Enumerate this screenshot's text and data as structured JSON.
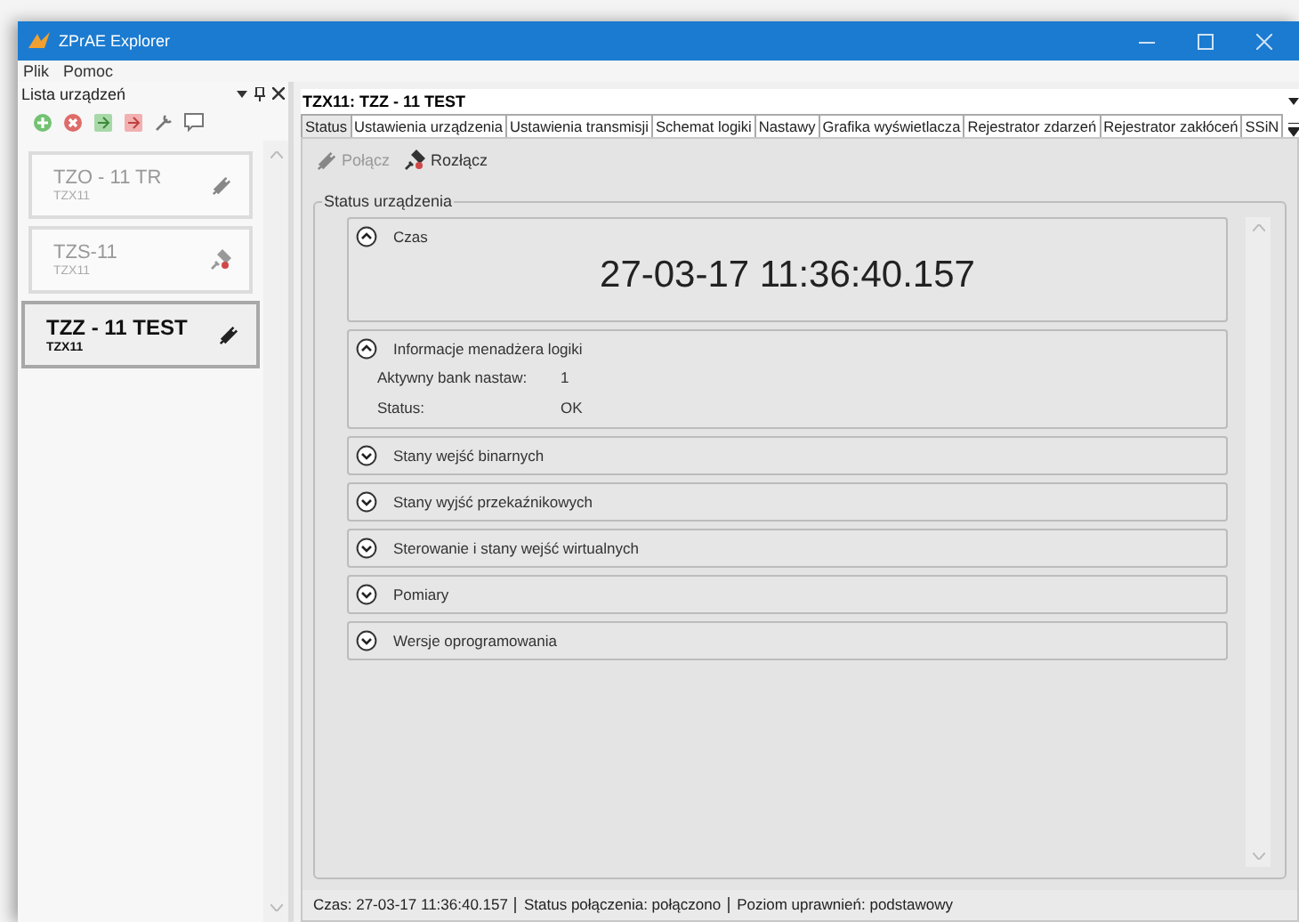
{
  "window": {
    "title": "ZPrAE Explorer"
  },
  "menu": [
    "Plik",
    "Pomoc"
  ],
  "sidebar": {
    "title": "Lista urządzeń",
    "items": [
      {
        "name": "TZO - 11 TR",
        "model": "TZX11",
        "kind": "plugged",
        "selected": false
      },
      {
        "name": "TZS-11",
        "model": "TZX11",
        "kind": "unplugged",
        "selected": false
      },
      {
        "name": "TZZ - 11 TEST",
        "model": "TZX11",
        "kind": "plugged",
        "selected": true
      }
    ]
  },
  "document": {
    "title": "TZX11: TZZ - 11 TEST",
    "tabs": [
      {
        "label": "Status",
        "selected": true
      },
      {
        "label": "Ustawienia urządzenia",
        "selected": false
      },
      {
        "label": "Ustawienia transmisji",
        "selected": false
      },
      {
        "label": "Schemat logiki",
        "selected": false
      },
      {
        "label": "Nastawy",
        "selected": false
      },
      {
        "label": "Grafika wyświetlacza",
        "selected": false
      },
      {
        "label": "Rejestrator zdarzeń",
        "selected": false
      },
      {
        "label": "Rejestrator zakłóceń",
        "selected": false
      },
      {
        "label": "SSiN",
        "selected": false
      }
    ],
    "toolbar": [
      {
        "label": "Połącz",
        "disabled": true,
        "kind": "plug"
      },
      {
        "label": "Rozłącz",
        "disabled": false,
        "kind": "unplug"
      }
    ],
    "group_title": "Status urządzenia",
    "sections": [
      {
        "title": "Czas",
        "expanded": true,
        "kind": "time",
        "value": "27-03-17 11:36:40.157"
      },
      {
        "title": "Informacje menadżera logiki",
        "expanded": true,
        "kind": "fields",
        "rows": [
          {
            "label": "Aktywny bank nastaw:",
            "value": "1"
          },
          {
            "label": "Status:",
            "value": "OK"
          }
        ]
      },
      {
        "title": "Stany wejść binarnych",
        "expanded": false
      },
      {
        "title": "Stany wyjść przekaźnikowych",
        "expanded": false
      },
      {
        "title": "Sterowanie i stany wejść wirtualnych",
        "expanded": false
      },
      {
        "title": "Pomiary",
        "expanded": false
      },
      {
        "title": "Wersje oprogramowania",
        "expanded": false
      }
    ]
  },
  "status_bar": [
    "Czas: 27-03-17 11:36:40.157",
    "Status połączenia: połączono",
    "Poziom uprawnień: podstawowy"
  ]
}
